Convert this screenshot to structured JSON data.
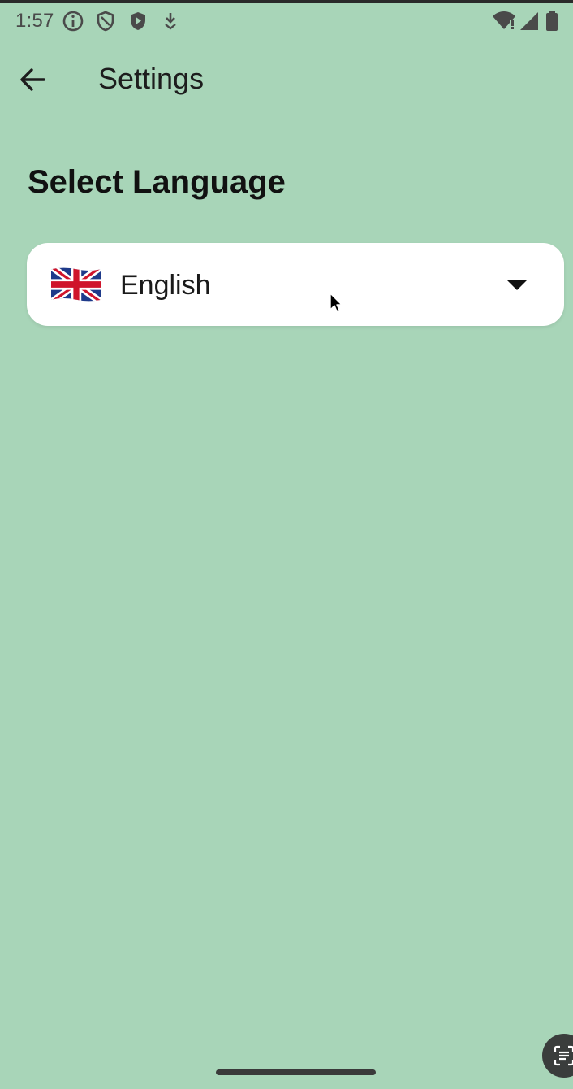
{
  "status_bar": {
    "time": "1:57",
    "left_icons": [
      "info-icon",
      "shield-outline-icon",
      "shield-play-icon",
      "download-icon"
    ],
    "right_icons": [
      "wifi-alert-icon",
      "signal-icon",
      "battery-icon"
    ]
  },
  "app_bar": {
    "back_icon": "arrow-left-icon",
    "title": "Settings"
  },
  "language_section": {
    "title": "Select Language",
    "selected": {
      "flag_icon": "uk-flag-icon",
      "label": "English"
    },
    "dropdown_icon": "triangle-down-icon"
  },
  "floating": {
    "scan_icon": "text-scan-icon"
  },
  "colors": {
    "background": "#a8d5b8",
    "card": "#ffffff",
    "text": "#1b1b1b"
  }
}
